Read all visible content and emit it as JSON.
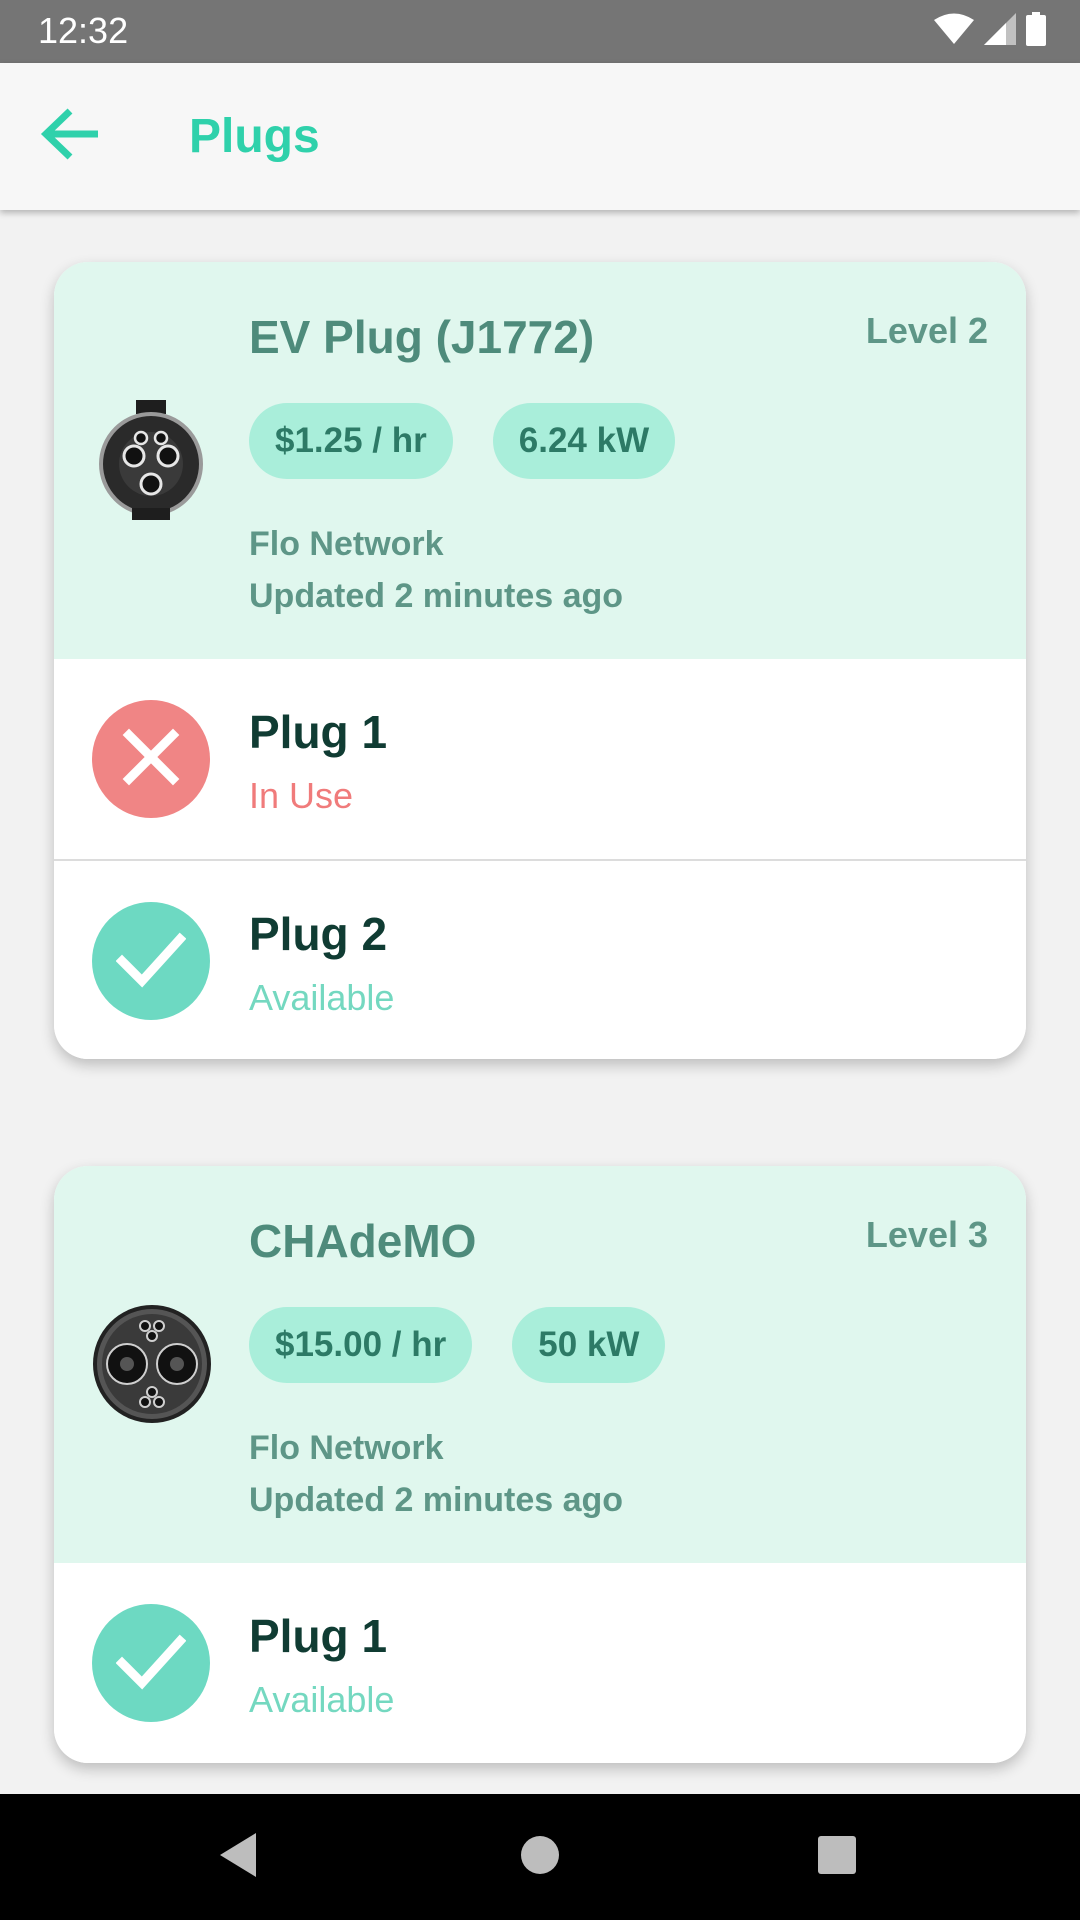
{
  "status_bar": {
    "time": "12:32",
    "icons": [
      "wifi-icon",
      "cellular-signal-icon",
      "battery-icon"
    ]
  },
  "app_bar": {
    "title": "Plugs",
    "back_icon": "arrow-left-icon",
    "accent_color": "#2fd1ab"
  },
  "stations": [
    {
      "title": "EV Plug (J1772)",
      "level": "Level 2",
      "connector_icon": "j1772-connector-icon",
      "price": "$1.25 / hr",
      "power": "6.24 kW",
      "network": "Flo Network",
      "updated": "Updated 2 minutes ago",
      "plugs": [
        {
          "name": "Plug 1",
          "status": "In Use",
          "state": "in-use",
          "icon": "close-icon"
        },
        {
          "name": "Plug 2",
          "status": "Available",
          "state": "available",
          "icon": "check-icon"
        }
      ]
    },
    {
      "title": "CHAdeMO",
      "level": "Level 3",
      "connector_icon": "chademo-connector-icon",
      "price": "$15.00 / hr",
      "power": "50 kW",
      "network": "Flo Network",
      "updated": "Updated 2 minutes ago",
      "plugs": [
        {
          "name": "Plug 1",
          "status": "Available",
          "state": "available",
          "icon": "check-icon"
        }
      ]
    }
  ],
  "colors": {
    "header_background": "#e0f7ee",
    "chip_background": "#a9eeda",
    "in_use": "#f08585",
    "available": "#6dd9c2"
  },
  "nav_bar": {
    "buttons": [
      "back-triangle-icon",
      "home-circle-icon",
      "recents-square-icon"
    ]
  }
}
